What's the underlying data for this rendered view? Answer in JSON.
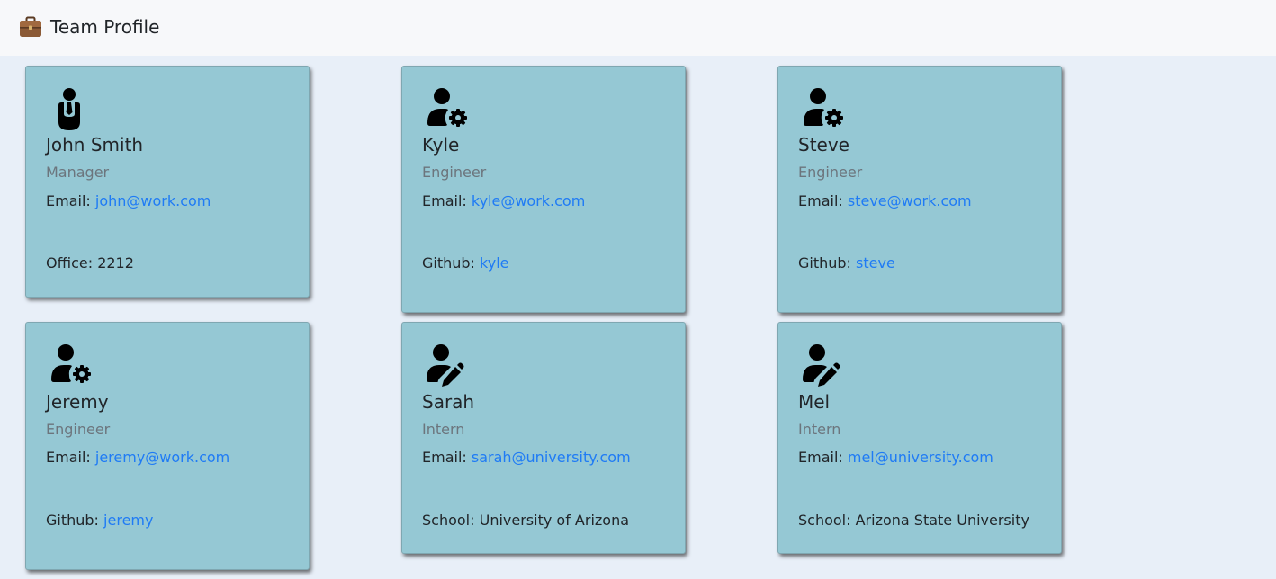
{
  "navbar": {
    "icon": "briefcase-icon",
    "title": "Team Profile"
  },
  "cards": [
    {
      "name": "John Smith",
      "role": "Manager",
      "role_icon": "manager-tie-icon",
      "email_label": "Email:",
      "email": "john@work.com",
      "extra_label": "Office:",
      "extra_value": "2212"
    },
    {
      "name": "Kyle",
      "role": "Engineer",
      "role_icon": "user-gear-icon",
      "email_label": "Email:",
      "email": "kyle@work.com",
      "extra_label": "Github:",
      "extra_value": "kyle"
    },
    {
      "name": "Steve",
      "role": "Engineer",
      "role_icon": "user-gear-icon",
      "email_label": "Email:",
      "email": "steve@work.com",
      "extra_label": "Github:",
      "extra_value": "steve"
    },
    {
      "name": "Jeremy",
      "role": "Engineer",
      "role_icon": "user-gear-icon",
      "email_label": "Email:",
      "email": "jeremy@work.com",
      "extra_label": "Github:",
      "extra_value": "jeremy"
    },
    {
      "name": "Sarah",
      "role": "Intern",
      "role_icon": "user-pen-icon",
      "email_label": "Email:",
      "email": "sarah@university.com",
      "extra_label": "School:",
      "extra_value": "University of Arizona"
    },
    {
      "name": "Mel",
      "role": "Intern",
      "role_icon": "user-pen-icon",
      "email_label": "Email:",
      "email": "mel@university.com",
      "extra_label": "School:",
      "extra_value": "Arizona State University"
    }
  ],
  "colors": {
    "card_background": "#95c8d4",
    "page_background": "#e8eff8",
    "navbar_background": "#f7f8fa",
    "link": "#1f7bf5",
    "muted": "#6c757d"
  }
}
